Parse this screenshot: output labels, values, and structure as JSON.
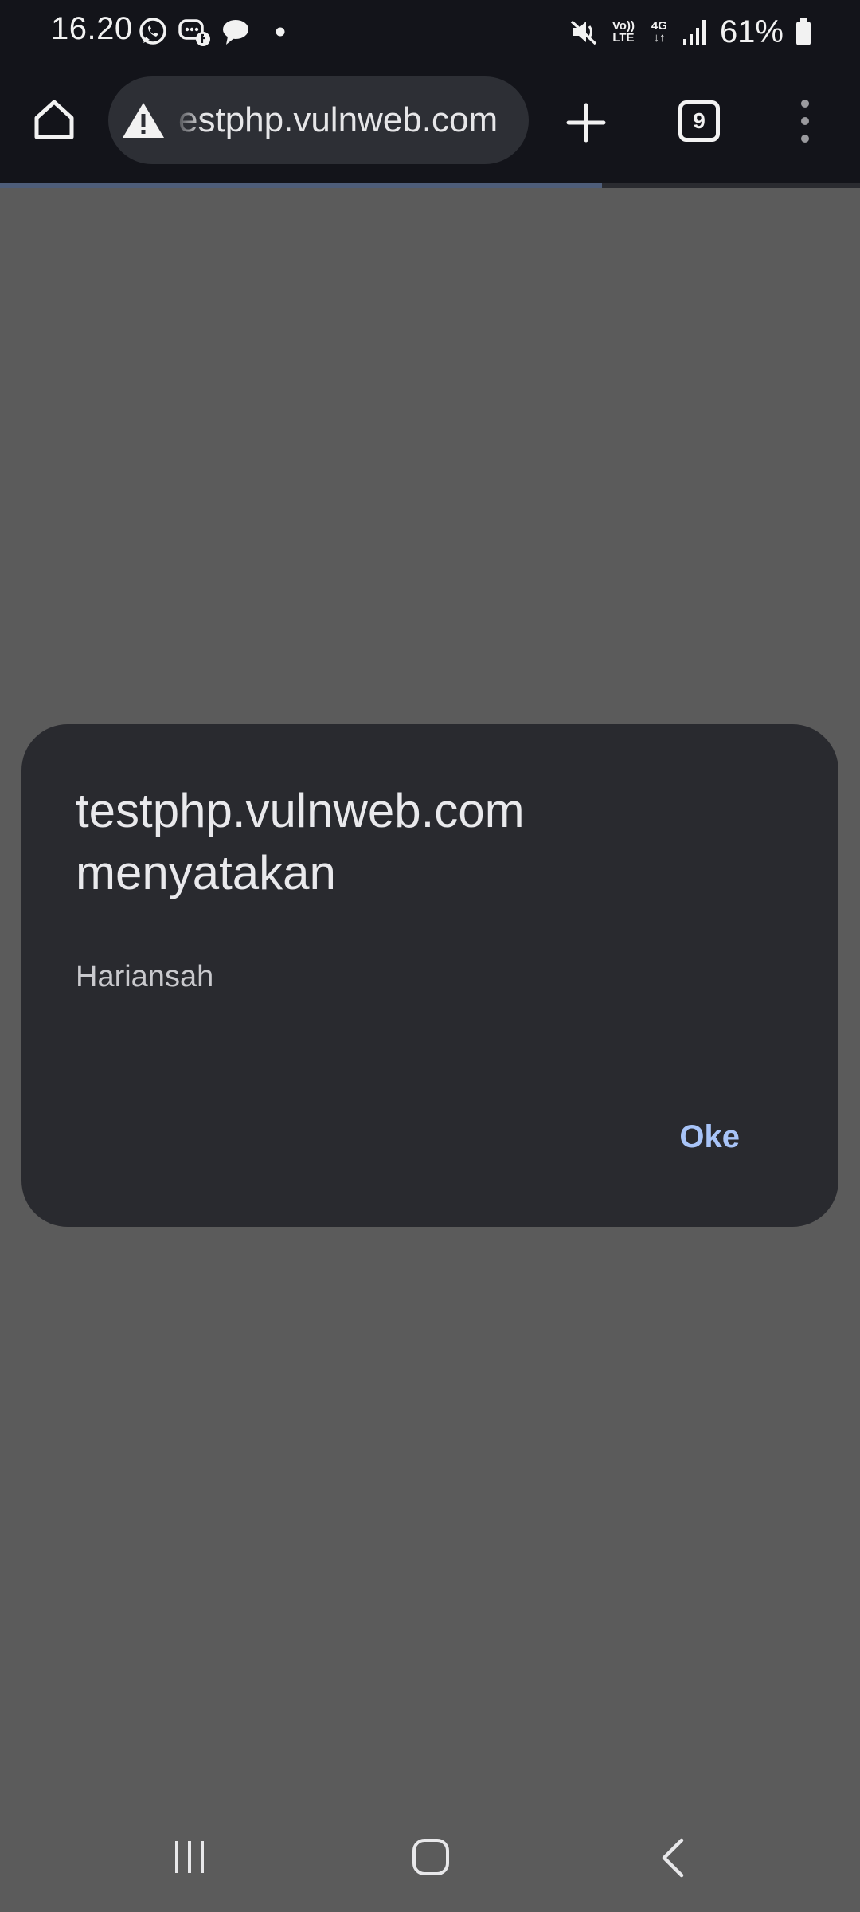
{
  "status_bar": {
    "time": "16.20",
    "battery_percent": "61%",
    "network_volte": "Vo))",
    "network_lte": "LTE",
    "network_4g": "4G",
    "icons": [
      "whatsapp-icon",
      "messenger-icon",
      "chat-bubble-icon",
      "notification-dot-icon",
      "mute-icon",
      "volte-icon",
      "4g-icon",
      "signal-icon",
      "battery-icon"
    ]
  },
  "toolbar": {
    "url": "testphp.vulnweb.com",
    "url_visible": "estphp.vulnweb.com",
    "tab_count": "9",
    "page_load_progress": 0.7
  },
  "dialog": {
    "title_line1": "testphp.vulnweb.com",
    "title_line2": "menyatakan",
    "message": "Hariansah",
    "ok_label": "Oke"
  },
  "colors": {
    "chrome_dark": "#13141a",
    "scrim": "#5b5b5b",
    "dialog_bg": "#292a2f",
    "accent": "#a8c4f8"
  }
}
